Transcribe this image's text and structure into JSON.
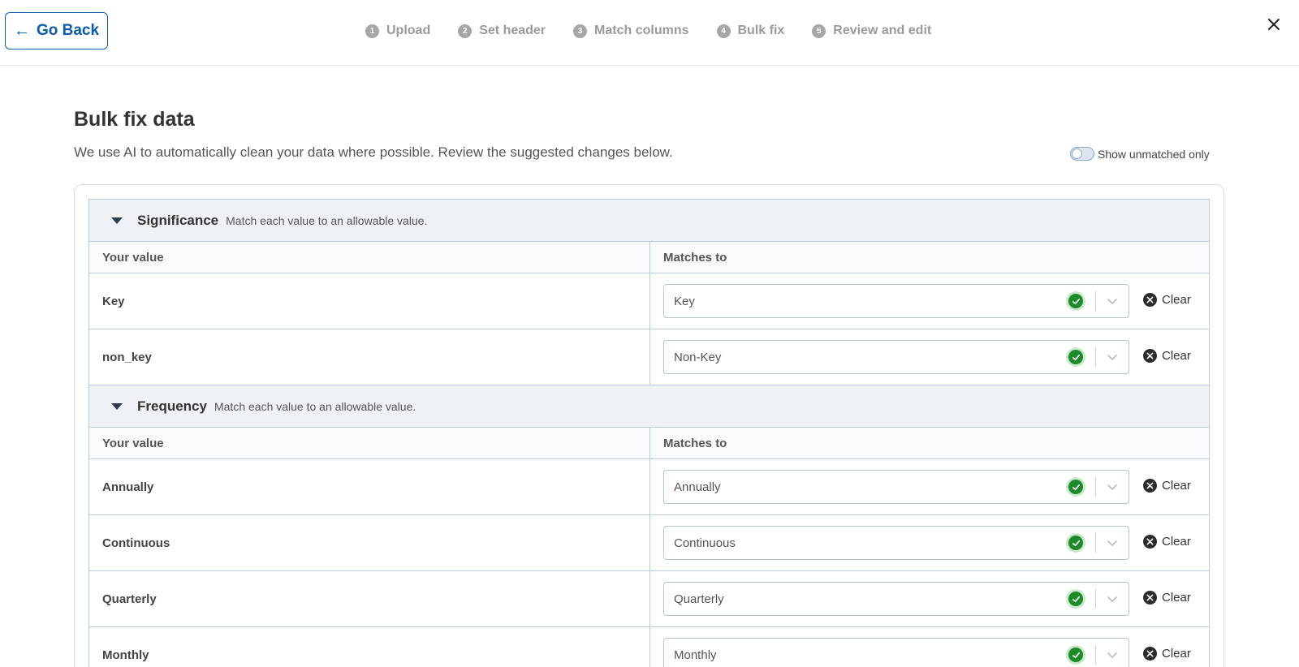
{
  "header": {
    "back_label": "Go Back",
    "steps": [
      {
        "num": "1",
        "label": "Upload"
      },
      {
        "num": "2",
        "label": "Set header"
      },
      {
        "num": "3",
        "label": "Match columns"
      },
      {
        "num": "4",
        "label": "Bulk fix"
      },
      {
        "num": "5",
        "label": "Review and edit"
      }
    ]
  },
  "page": {
    "title": "Bulk fix data",
    "subtitle": "We use AI to automatically clean your data where possible. Review the suggested changes below.",
    "toggle_label": "Show unmatched only"
  },
  "columns": {
    "your_value": "Your value",
    "matches_to": "Matches to"
  },
  "clear_label": "Clear",
  "groups": [
    {
      "name": "Significance",
      "desc": "Match each value to an allowable value.",
      "rows": [
        {
          "value": "Key",
          "match": "Key"
        },
        {
          "value": "non_key",
          "match": "Non-Key"
        }
      ]
    },
    {
      "name": "Frequency",
      "desc": "Match each value to an allowable value.",
      "rows": [
        {
          "value": "Annually",
          "match": "Annually"
        },
        {
          "value": "Continuous",
          "match": "Continuous"
        },
        {
          "value": "Quarterly",
          "match": "Quarterly"
        },
        {
          "value": "Monthly",
          "match": "Monthly"
        }
      ]
    }
  ],
  "colors": {
    "accent": "#0b5cad",
    "success": "#1f8a2a",
    "border": "#b8cbe0"
  },
  "icons": {
    "back": "arrow-left-icon",
    "close": "close-icon",
    "caret": "caret-down-icon",
    "check": "check-circle-icon",
    "chevron": "chevron-down-icon",
    "clear": "clear-circle-icon"
  }
}
